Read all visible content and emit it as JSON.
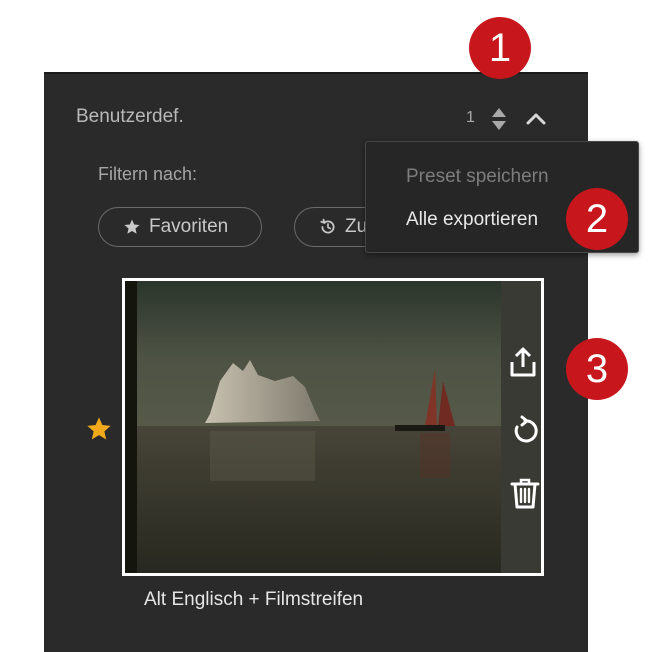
{
  "panel": {
    "title": "Benutzerdef.",
    "preset_count": "1",
    "filter_label": "Filtern nach:",
    "filters": [
      {
        "label": "Favoriten",
        "icon": "star-icon"
      },
      {
        "label": "Zu",
        "icon": "history-icon"
      }
    ]
  },
  "menu": {
    "items": [
      {
        "label": "Preset speichern",
        "state": "disabled"
      },
      {
        "label": "Alle exportieren",
        "state": "enabled"
      }
    ]
  },
  "callouts": [
    "1",
    "2",
    "3"
  ],
  "preset": {
    "name": "Alt Englisch + Filmstreifen",
    "favorite": true,
    "actions": [
      "export-icon",
      "reset-icon",
      "trash-icon"
    ]
  },
  "colors": {
    "panel_bg": "#2a2a2a",
    "callout_red": "#c8161d",
    "star_gold": "#f0a91b"
  }
}
